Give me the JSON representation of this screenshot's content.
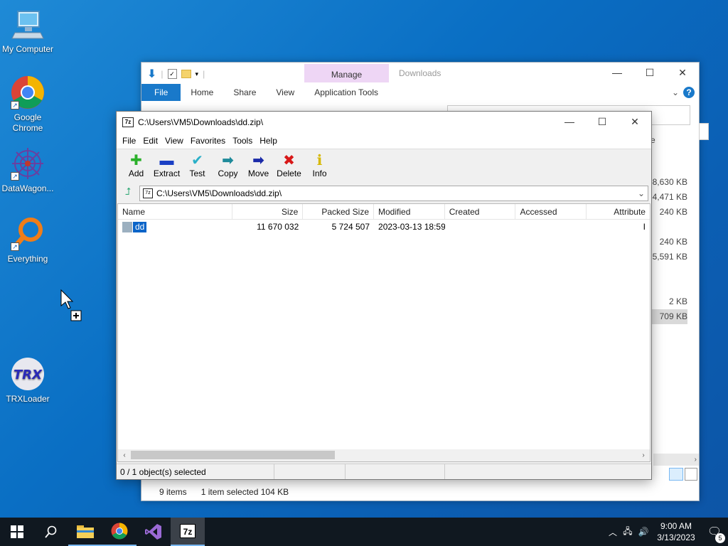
{
  "desktop": {
    "icons": [
      {
        "label": "My Computer",
        "icon": "computer-icon"
      },
      {
        "label": "Google Chrome",
        "icon": "chrome-icon"
      },
      {
        "label": "DataWagon...",
        "icon": "datawagon-icon"
      },
      {
        "label": "Everything",
        "icon": "everything-icon"
      },
      {
        "label": "TRXLoader",
        "icon": "trxloader-icon",
        "logo_text": "TRX"
      }
    ]
  },
  "explorer": {
    "title": "Downloads",
    "context_tab": "Manage",
    "ribbon_tabs": [
      "File",
      "Home",
      "Share",
      "View",
      "Application Tools"
    ],
    "sizes": [
      "38,630 KB",
      "4,471 KB",
      "240 KB",
      "",
      "240 KB",
      "5,591 KB",
      "",
      "",
      "2 KB",
      "709 KB"
    ],
    "status": {
      "items": "9 items",
      "selected": "1 item selected  104 KB"
    },
    "peek_header": "e"
  },
  "zip": {
    "title": "C:\\Users\\VM5\\Downloads\\dd.zip\\",
    "app_icon": "7z",
    "menu": [
      "File",
      "Edit",
      "View",
      "Favorites",
      "Tools",
      "Help"
    ],
    "toolbar": [
      {
        "label": "Add",
        "icon": "plus-icon",
        "color": "#2bb02b"
      },
      {
        "label": "Extract",
        "icon": "minus-icon",
        "color": "#1a3fc4"
      },
      {
        "label": "Test",
        "icon": "check-icon",
        "color": "#2ab0c8"
      },
      {
        "label": "Copy",
        "icon": "double-arrow-icon",
        "color": "#1e8a9a"
      },
      {
        "label": "Move",
        "icon": "arrow-right-icon",
        "color": "#1a2aa8"
      },
      {
        "label": "Delete",
        "icon": "x-icon",
        "color": "#d81818"
      },
      {
        "label": "Info",
        "icon": "info-icon",
        "color": "#d6b800"
      }
    ],
    "address": "C:\\Users\\VM5\\Downloads\\dd.zip\\",
    "columns": [
      "Name",
      "Size",
      "Packed Size",
      "Modified",
      "Created",
      "Accessed",
      "Attribute"
    ],
    "rows": [
      {
        "name": "dd",
        "size": "11 670 032",
        "packed": "5 724 507",
        "modified": "2023-03-13 18:59",
        "created": "",
        "accessed": "",
        "attr": "I"
      }
    ],
    "status": "0 / 1 object(s) selected"
  },
  "taskbar": {
    "clock_time": "9:00 AM",
    "clock_date": "3/13/2023",
    "notification_count": "5",
    "active_item": "7z"
  },
  "colors": {
    "accent": "#1979ca",
    "selection": "#0a64c8",
    "manage_tab": "#eed6f5"
  }
}
